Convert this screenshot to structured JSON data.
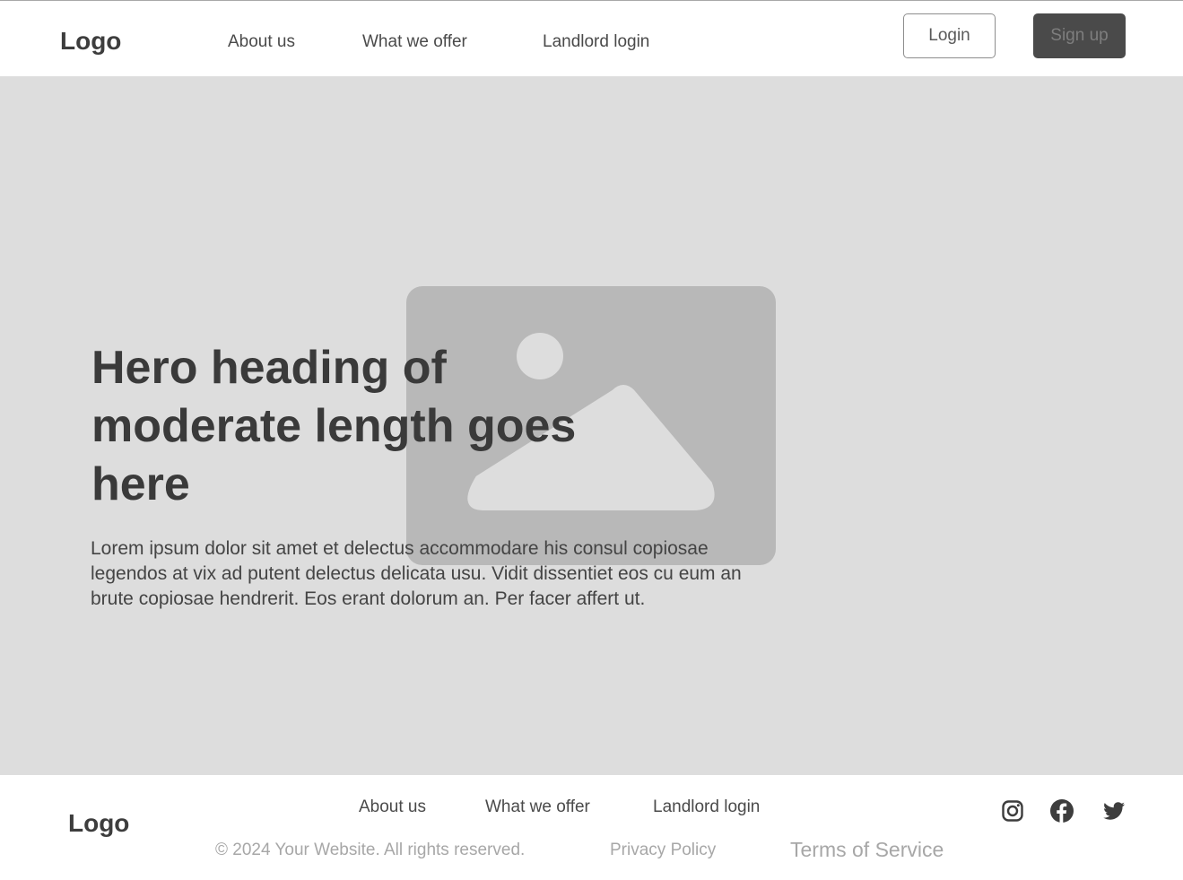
{
  "header": {
    "logo": "Logo",
    "nav": {
      "about": "About us",
      "offer": "What we offer",
      "landlord": "Landlord login"
    },
    "login_label": "Login",
    "signup_label": "Sign up"
  },
  "hero": {
    "heading": "Hero heading of moderate length goes here",
    "body": "Lorem ipsum dolor sit amet et delectus accommodare his consul copiosae legendos at vix ad putent delectus delicata usu. Vidit dissentiet eos cu eum an brute copiosae hendrerit. Eos erant dolorum an. Per facer affert ut.",
    "image_icon": "image-placeholder-icon"
  },
  "footer": {
    "logo": "Logo",
    "nav": {
      "about": "About us",
      "offer": "What we offer",
      "landlord": "Landlord login"
    },
    "copyright": "© 2024 Your Website. All rights reserved.",
    "privacy": "Privacy Policy",
    "terms": "Terms of Service",
    "social_icons": [
      "instagram-icon",
      "facebook-icon",
      "twitter-icon"
    ]
  },
  "colors": {
    "hero_bg": "#dddddd",
    "placeholder": "#b8b8b8",
    "signup_bg": "#4a4a4a",
    "text_dark": "#3d3d3d",
    "text_muted": "#a7a7a7"
  }
}
